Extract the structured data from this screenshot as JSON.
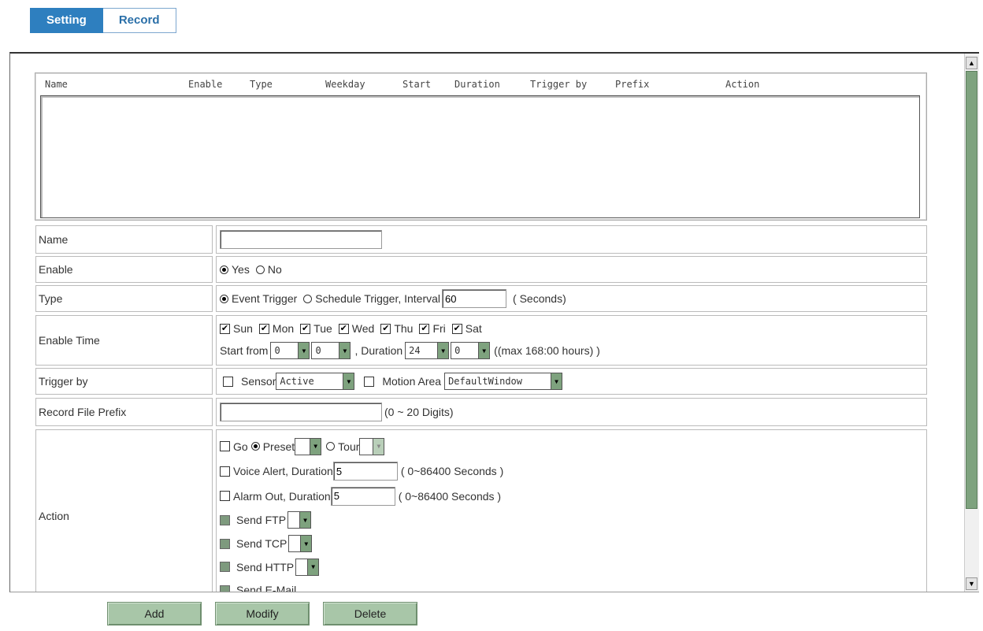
{
  "tabs": {
    "setting": "Setting",
    "record": "Record"
  },
  "list": {
    "headers": [
      "Name",
      "Enable",
      "Type",
      "Weekday",
      "Start",
      "Duration",
      "Trigger by",
      "Prefix",
      "Action"
    ]
  },
  "form": {
    "name": {
      "label": "Name",
      "value": ""
    },
    "enable": {
      "label": "Enable",
      "yes": "Yes",
      "no": "No"
    },
    "type": {
      "label": "Type",
      "event": "Event Trigger",
      "schedule": "Schedule Trigger, Interval",
      "interval": "60",
      "unit": "( Seconds)"
    },
    "enable_time": {
      "label": "Enable Time",
      "days": [
        "Sun",
        "Mon",
        "Tue",
        "Wed",
        "Thu",
        "Fri",
        "Sat"
      ],
      "start_label": "Start from",
      "start_hour": "0",
      "start_min": "0",
      "duration_label": ", Duration",
      "duration_hour": "24",
      "duration_min": "0",
      "max_note": "((max 168:00 hours) )"
    },
    "trigger_by": {
      "label": "Trigger by",
      "sensor": "Sensor",
      "sensor_value": "Active",
      "motion": "Motion Area",
      "motion_value": "DefaultWindow"
    },
    "prefix": {
      "label": "Record File Prefix",
      "value": "",
      "note": "(0 ~ 20 Digits)"
    },
    "action": {
      "label": "Action",
      "go": "Go",
      "preset": "Preset",
      "tour": "Tour",
      "voice": "Voice Alert, Duration",
      "voice_value": "5",
      "voice_note": "( 0~86400 Seconds )",
      "alarm": "Alarm Out, Duration",
      "alarm_value": "5",
      "alarm_note": "( 0~86400 Seconds )",
      "ftp": "Send FTP",
      "tcp": "Send TCP",
      "http": "Send HTTP",
      "email": "Send E-Mail"
    }
  },
  "buttons": {
    "add": "Add",
    "modify": "Modify",
    "delete": "Delete"
  },
  "colors": {
    "tab_active": "#2e7fbf",
    "button": "#a8c6a8",
    "scroll_thumb": "#7ea27e"
  }
}
